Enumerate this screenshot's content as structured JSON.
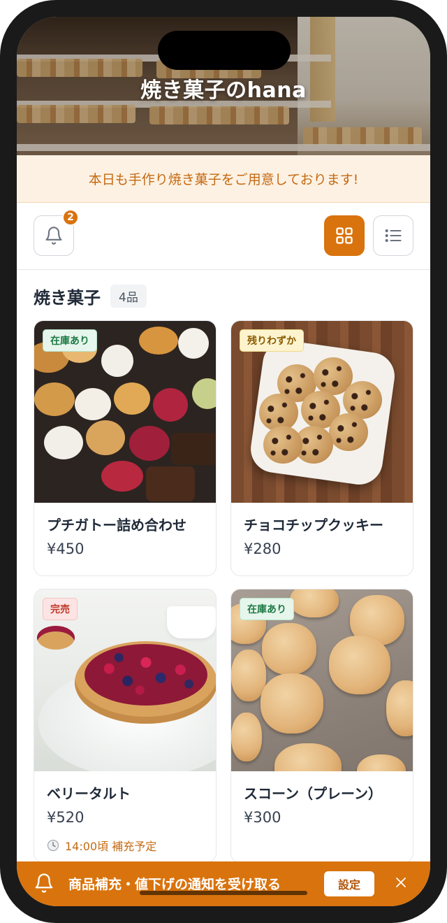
{
  "header": {
    "title": "焼き菓子のhana",
    "notice": "本日も手作り焼き菓子をご用意しております!"
  },
  "toolbar": {
    "notification_count": "2",
    "active_view": "grid"
  },
  "section": {
    "title": "焼き菓子",
    "count": "4品"
  },
  "products": [
    {
      "name": "プチガトー詰め合わせ",
      "price": "¥450",
      "stock": "在庫あり",
      "stock_state": "ok",
      "image": "petit-gateaux-photo"
    },
    {
      "name": "チョコチップクッキー",
      "price": "¥280",
      "stock": "残りわずか",
      "stock_state": "low",
      "image": "chocolate-chip-cookies-photo"
    },
    {
      "name": "ベリータルト",
      "price": "¥520",
      "stock": "完売",
      "stock_state": "out",
      "restock": "14:00頃 補充予定",
      "image": "berry-tart-photo"
    },
    {
      "name": "スコーン（プレーン）",
      "price": "¥300",
      "stock": "在庫あり",
      "stock_state": "ok",
      "image": "scones-photo"
    }
  ],
  "banner": {
    "text": "商品補充・値下げの通知を受け取る",
    "settings_label": "設定"
  },
  "colors": {
    "accent": "#d9730d",
    "notice_bg": "#fdf1e3",
    "stock_ok": "#1f7a45",
    "stock_low": "#8a5a00",
    "stock_out": "#c0392b"
  }
}
